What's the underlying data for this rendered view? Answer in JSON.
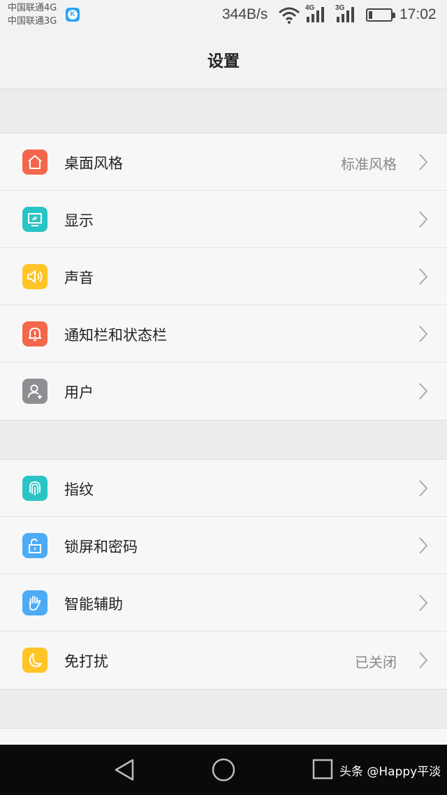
{
  "status_bar": {
    "carrier_1": "中国联通4G",
    "carrier_2": "中国联通3G",
    "app_icon": "k-app-icon",
    "net_speed": "344B/s",
    "signal_1_tag": "4G",
    "signal_2_tag": "3G",
    "battery_level": 0.15,
    "time": "17:02"
  },
  "header": {
    "title": "设置"
  },
  "groups": [
    {
      "items": [
        {
          "label": "桌面风格",
          "value": "标准风格",
          "icon": "home-icon",
          "color": "#f4674c"
        },
        {
          "label": "显示",
          "value": "",
          "icon": "display-icon",
          "color": "#2bc4c4"
        },
        {
          "label": "声音",
          "value": "",
          "icon": "speaker-icon",
          "color": "#ffc426"
        },
        {
          "label": "通知栏和状态栏",
          "value": "",
          "icon": "bell-icon",
          "color": "#f4674c"
        },
        {
          "label": "用户",
          "value": "",
          "icon": "user-icon",
          "color": "#8e8e93"
        }
      ]
    },
    {
      "items": [
        {
          "label": "指纹",
          "value": "",
          "icon": "fingerprint-icon",
          "color": "#2bc4c4"
        },
        {
          "label": "锁屏和密码",
          "value": "",
          "icon": "unlock-icon",
          "color": "#4dabf5"
        },
        {
          "label": "智能辅助",
          "value": "",
          "icon": "hand-icon",
          "color": "#4dabf5"
        },
        {
          "label": "免打扰",
          "value": "已关闭",
          "icon": "moon-icon",
          "color": "#ffc426"
        }
      ]
    }
  ],
  "nav_bar": {
    "back": "back-icon",
    "home": "home-circle-icon",
    "recent": "recent-apps-icon",
    "watermark": "头条 @Happy平淡"
  }
}
